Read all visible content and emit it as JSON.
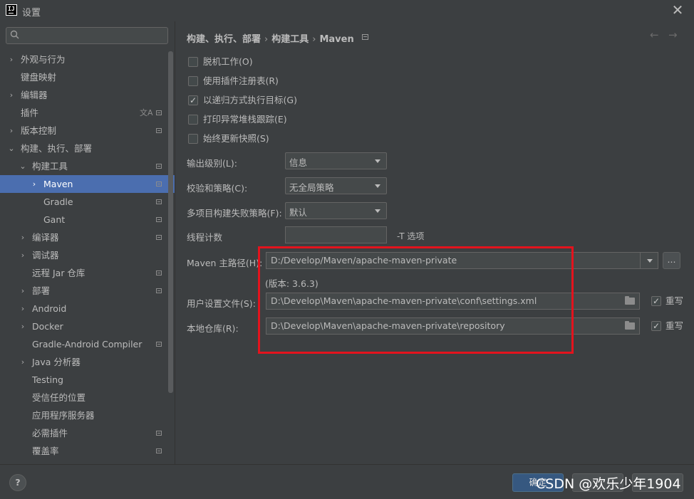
{
  "window": {
    "title": "设置"
  },
  "search": {
    "placeholder": ""
  },
  "sidebar": {
    "items": [
      {
        "label": "外观与行为",
        "chevron": "›",
        "config": false
      },
      {
        "label": "键盘映射",
        "chevron": "",
        "config": false
      },
      {
        "label": "编辑器",
        "chevron": "›",
        "config": false
      },
      {
        "label": "插件",
        "chevron": "",
        "config": true,
        "translate_icon": "文A"
      },
      {
        "label": "版本控制",
        "chevron": "›",
        "config": true
      },
      {
        "label": "构建、执行、部署",
        "chevron": "⌄",
        "config": false
      },
      {
        "label": "构建工具",
        "chevron": "⌄",
        "config": true
      },
      {
        "label": "Maven",
        "chevron": "›",
        "config": true,
        "selected": true
      },
      {
        "label": "Gradle",
        "chevron": "",
        "config": true
      },
      {
        "label": "Gant",
        "chevron": "",
        "config": true
      },
      {
        "label": "编译器",
        "chevron": "›",
        "config": true
      },
      {
        "label": "调试器",
        "chevron": "›",
        "config": false
      },
      {
        "label": "远程 Jar 仓库",
        "chevron": "",
        "config": true
      },
      {
        "label": "部署",
        "chevron": "›",
        "config": true
      },
      {
        "label": "Android",
        "chevron": "›",
        "config": false
      },
      {
        "label": "Docker",
        "chevron": "›",
        "config": false
      },
      {
        "label": "Gradle-Android Compiler",
        "chevron": "",
        "config": true
      },
      {
        "label": "Java 分析器",
        "chevron": "›",
        "config": false
      },
      {
        "label": "Testing",
        "chevron": "",
        "config": false
      },
      {
        "label": "受信任的位置",
        "chevron": "",
        "config": false
      },
      {
        "label": "应用程序服务器",
        "chevron": "",
        "config": false
      },
      {
        "label": "必需插件",
        "chevron": "",
        "config": true
      },
      {
        "label": "覆盖率",
        "chevron": "",
        "config": true
      }
    ]
  },
  "breadcrumb": {
    "part1": "构建、执行、部署",
    "sep": "›",
    "part2": "构建工具",
    "part3": "Maven"
  },
  "nav": {
    "back": "←",
    "forward": "→"
  },
  "options": [
    {
      "label": "脱机工作(O)",
      "checked": false
    },
    {
      "label": "使用插件注册表(R)",
      "checked": false
    },
    {
      "label": "以递归方式执行目标(G)",
      "checked": true
    },
    {
      "label": "打印异常堆栈跟踪(E)",
      "checked": false
    },
    {
      "label": "始终更新快照(S)",
      "checked": false
    }
  ],
  "form": {
    "output_level_label": "输出级别(L):",
    "output_level_value": "信息",
    "checksum_label": "校验和策略(C):",
    "checksum_value": "无全局策略",
    "failure_label": "多项目构建失败策略(F):",
    "failure_value": "默认",
    "threads_label": "线程计数",
    "threads_value": "",
    "threads_hint": "-T 选项",
    "maven_home_label": "Maven 主路径(H):",
    "maven_home_value": "D:/Develop/Maven/apache-maven-private",
    "browse_label": "...",
    "version": "(版本: 3.6.3)",
    "user_settings_label": "用户设置文件(S):",
    "user_settings_value": "D:\\Develop\\Maven\\apache-maven-private\\conf\\settings.xml",
    "user_settings_override": true,
    "local_repo_label": "本地仓库(R):",
    "local_repo_value": "D:\\Develop\\Maven\\apache-maven-private\\repository",
    "local_repo_override": true,
    "override_label": "重写"
  },
  "buttons": {
    "help": "?",
    "ok": "确定",
    "cancel": "",
    "apply": ""
  },
  "watermark": "CSDN @欢乐少年1904",
  "colors": {
    "background": "#3c3f41",
    "selection": "#4b6eaf",
    "highlight_box": "#e3131d",
    "ok_button": "#365880"
  },
  "icons": {
    "logo": "intellij-logo",
    "search": "search-icon",
    "close": "close-icon",
    "folder": "folder-icon",
    "config": "settings-config-icon"
  }
}
